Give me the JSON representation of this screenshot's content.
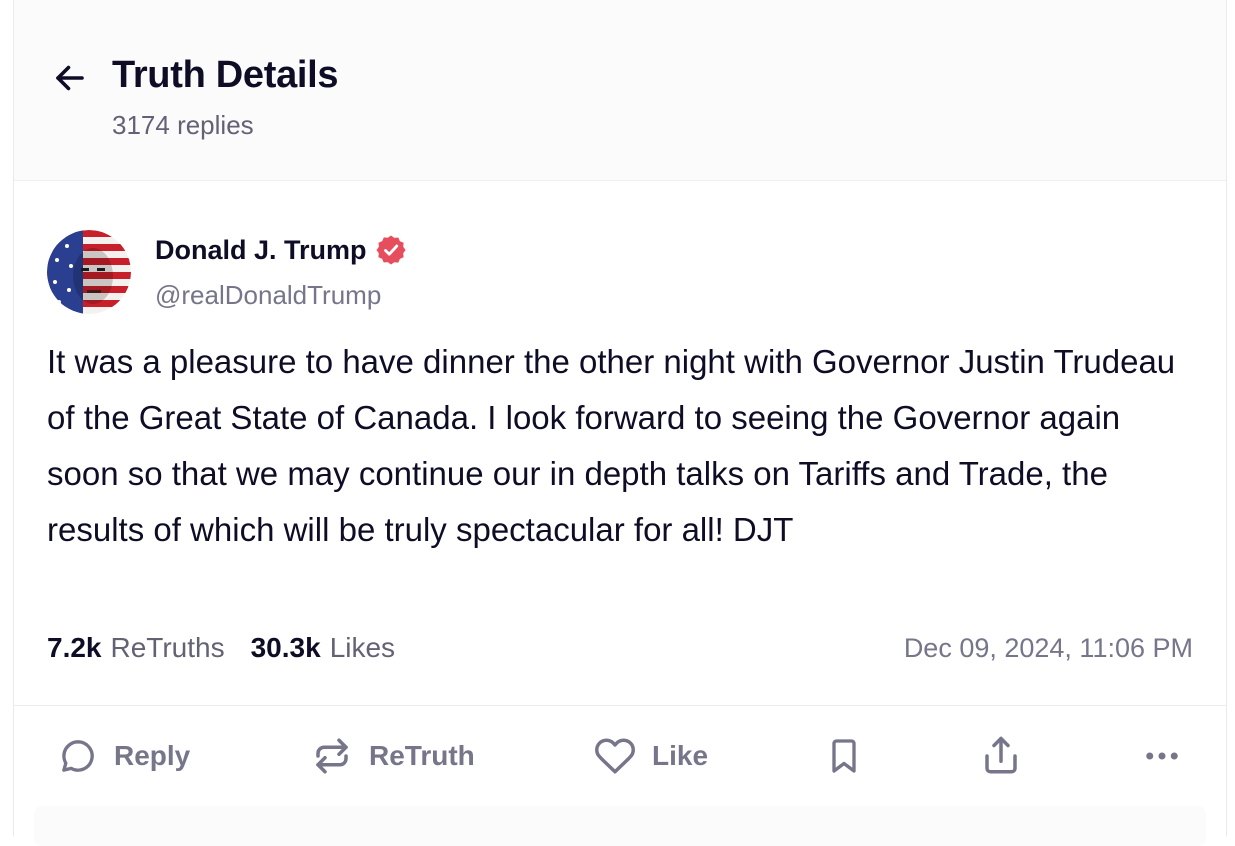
{
  "header": {
    "title": "Truth Details",
    "replies": "3174 replies"
  },
  "post": {
    "author_name": "Donald J. Trump",
    "handle": "@realDonaldTrump",
    "text": "It was a pleasure to have dinner the other night with Governor Justin Trudeau of the Great State of Canada. I look forward to seeing the Governor again soon so that we may continue our in depth talks on Tariffs and Trade, the results of which will be truly spectacular for all! DJT",
    "retruths_count": "7.2k",
    "retruths_label": "ReTruths",
    "likes_count": "30.3k",
    "likes_label": "Likes",
    "timestamp": "Dec 09, 2024, 11:06 PM"
  },
  "actions": {
    "reply_label": "Reply",
    "retruth_label": "ReTruth",
    "like_label": "Like"
  },
  "icons": {
    "back": "arrow-left-icon",
    "verified": "verified-badge-icon",
    "reply": "speech-bubble-icon",
    "retruth": "repost-arrows-icon",
    "like": "heart-icon",
    "bookmark": "bookmark-icon",
    "share": "share-icon",
    "more": "more-dots-icon"
  },
  "colors": {
    "text": "#0f0d26",
    "muted": "#76758a",
    "verified": "#e64e5e"
  }
}
